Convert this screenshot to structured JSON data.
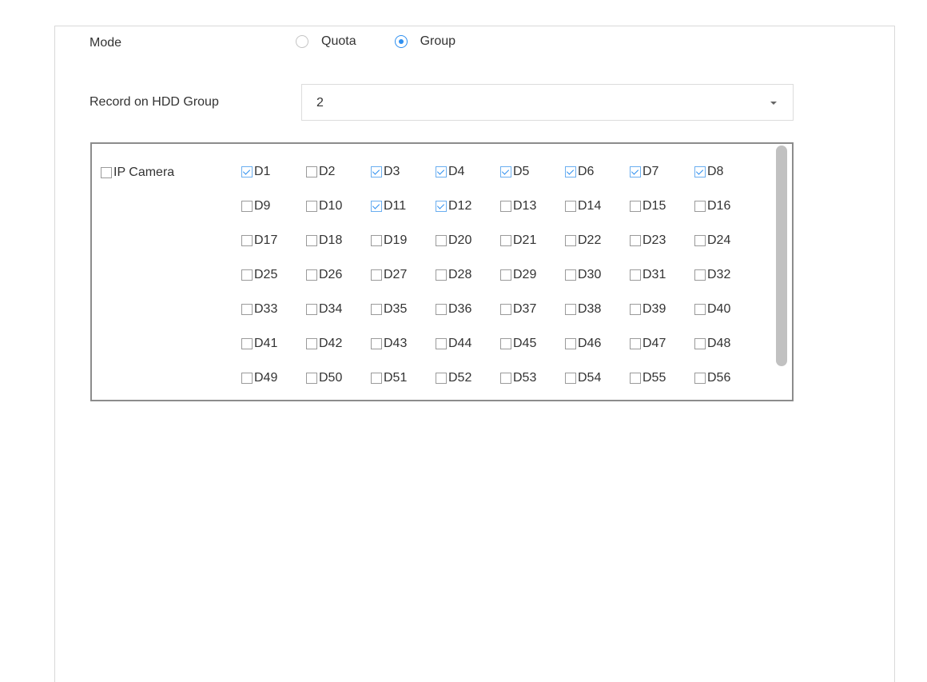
{
  "mode": {
    "label": "Mode",
    "options": [
      {
        "label": "Quota",
        "checked": false
      },
      {
        "label": "Group",
        "checked": true
      }
    ]
  },
  "hdd_group": {
    "label": "Record on HDD Group",
    "value": "2"
  },
  "cameras": {
    "group_label": "IP Camera",
    "group_checked": false,
    "items": [
      {
        "label": "D1",
        "checked": true
      },
      {
        "label": "D2",
        "checked": false
      },
      {
        "label": "D3",
        "checked": true
      },
      {
        "label": "D4",
        "checked": true
      },
      {
        "label": "D5",
        "checked": true
      },
      {
        "label": "D6",
        "checked": true
      },
      {
        "label": "D7",
        "checked": true
      },
      {
        "label": "D8",
        "checked": true
      },
      {
        "label": "D9",
        "checked": false
      },
      {
        "label": "D10",
        "checked": false
      },
      {
        "label": "D11",
        "checked": true
      },
      {
        "label": "D12",
        "checked": true
      },
      {
        "label": "D13",
        "checked": false
      },
      {
        "label": "D14",
        "checked": false
      },
      {
        "label": "D15",
        "checked": false
      },
      {
        "label": "D16",
        "checked": false
      },
      {
        "label": "D17",
        "checked": false
      },
      {
        "label": "D18",
        "checked": false
      },
      {
        "label": "D19",
        "checked": false
      },
      {
        "label": "D20",
        "checked": false
      },
      {
        "label": "D21",
        "checked": false
      },
      {
        "label": "D22",
        "checked": false
      },
      {
        "label": "D23",
        "checked": false
      },
      {
        "label": "D24",
        "checked": false
      },
      {
        "label": "D25",
        "checked": false
      },
      {
        "label": "D26",
        "checked": false
      },
      {
        "label": "D27",
        "checked": false
      },
      {
        "label": "D28",
        "checked": false
      },
      {
        "label": "D29",
        "checked": false
      },
      {
        "label": "D30",
        "checked": false
      },
      {
        "label": "D31",
        "checked": false
      },
      {
        "label": "D32",
        "checked": false
      },
      {
        "label": "D33",
        "checked": false
      },
      {
        "label": "D34",
        "checked": false
      },
      {
        "label": "D35",
        "checked": false
      },
      {
        "label": "D36",
        "checked": false
      },
      {
        "label": "D37",
        "checked": false
      },
      {
        "label": "D38",
        "checked": false
      },
      {
        "label": "D39",
        "checked": false
      },
      {
        "label": "D40",
        "checked": false
      },
      {
        "label": "D41",
        "checked": false
      },
      {
        "label": "D42",
        "checked": false
      },
      {
        "label": "D43",
        "checked": false
      },
      {
        "label": "D44",
        "checked": false
      },
      {
        "label": "D45",
        "checked": false
      },
      {
        "label": "D46",
        "checked": false
      },
      {
        "label": "D47",
        "checked": false
      },
      {
        "label": "D48",
        "checked": false
      },
      {
        "label": "D49",
        "checked": false
      },
      {
        "label": "D50",
        "checked": false
      },
      {
        "label": "D51",
        "checked": false
      },
      {
        "label": "D52",
        "checked": false
      },
      {
        "label": "D53",
        "checked": false
      },
      {
        "label": "D54",
        "checked": false
      },
      {
        "label": "D55",
        "checked": false
      },
      {
        "label": "D56",
        "checked": false
      },
      {
        "label": "",
        "checked": false
      },
      {
        "label": "",
        "checked": false
      },
      {
        "label": "",
        "checked": false
      },
      {
        "label": "",
        "checked": false
      },
      {
        "label": "",
        "checked": false
      },
      {
        "label": "",
        "checked": false
      },
      {
        "label": "",
        "checked": false
      },
      {
        "label": "",
        "checked": false
      }
    ]
  },
  "colors": {
    "accent": "#2e8ff0",
    "border": "#d9d9d9",
    "scrollbar": "#c1c1c1"
  }
}
